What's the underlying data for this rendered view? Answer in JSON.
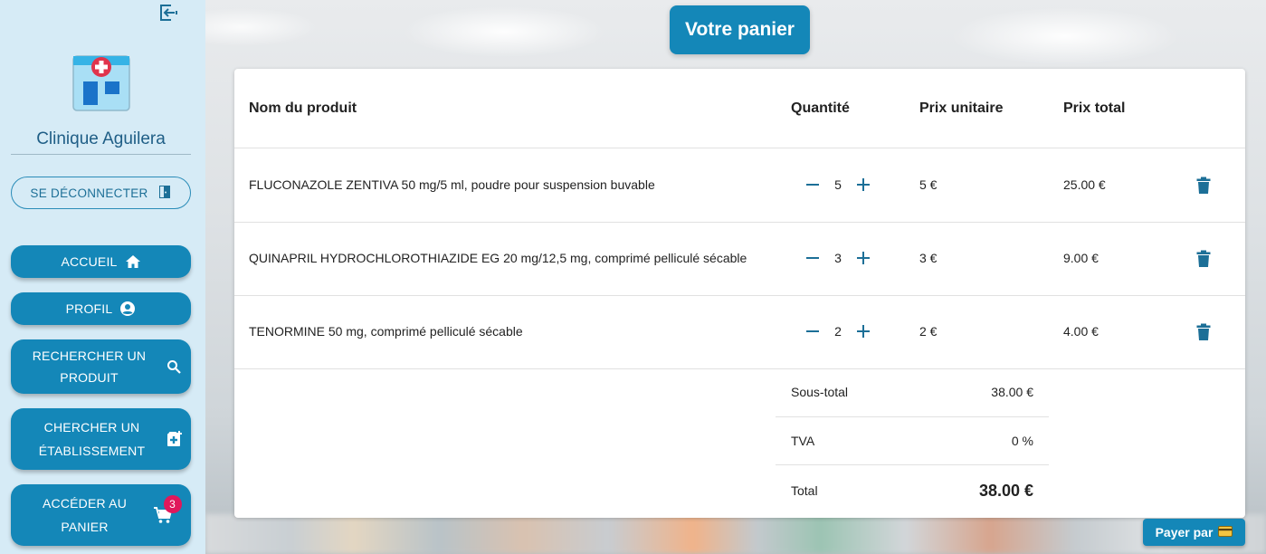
{
  "sidebar": {
    "collapse_icon": "collapse-sidebar-icon",
    "clinic_name": "Clinique Aguilera",
    "logout_label": "SE DÉCONNECTER",
    "nav": {
      "home": "ACCUEIL",
      "profile": "PROFIL",
      "search_product": "RECHERCHER UN PRODUIT",
      "find_establishment": "CHERCHER UN ÉTABLISSEMENT",
      "cart": "ACCÉDER AU PANIER",
      "cart_count": "3"
    }
  },
  "title": "Votre panier",
  "table": {
    "headers": {
      "product": "Nom du produit",
      "quantity": "Quantité",
      "unit_price": "Prix unitaire",
      "total_price": "Prix total"
    },
    "rows": [
      {
        "name": "FLUCONAZOLE ZENTIVA 50 mg/5 ml, poudre pour suspension buvable",
        "qty": "5",
        "unit": "5 €",
        "total": "25.00 €"
      },
      {
        "name": "QUINAPRIL HYDROCHLOROTHIAZIDE EG 20 mg/12,5 mg, comprimé pelliculé sécable",
        "qty": "3",
        "unit": "3 €",
        "total": "9.00 €"
      },
      {
        "name": "TENORMINE 50 mg, comprimé pelliculé sécable",
        "qty": "2",
        "unit": "2 €",
        "total": "4.00 €"
      }
    ]
  },
  "summary": {
    "subtotal_label": "Sous-total",
    "subtotal_value": "38.00 €",
    "tax_label": "TVA",
    "tax_value": "0 %",
    "total_label": "Total",
    "total_value": "38.00 €"
  },
  "pay_label": "Payer par",
  "colors": {
    "primary": "#1487b8",
    "sidebar_bg": "#d6ebf6",
    "badge": "#e0185b",
    "text_dark": "#222222"
  }
}
